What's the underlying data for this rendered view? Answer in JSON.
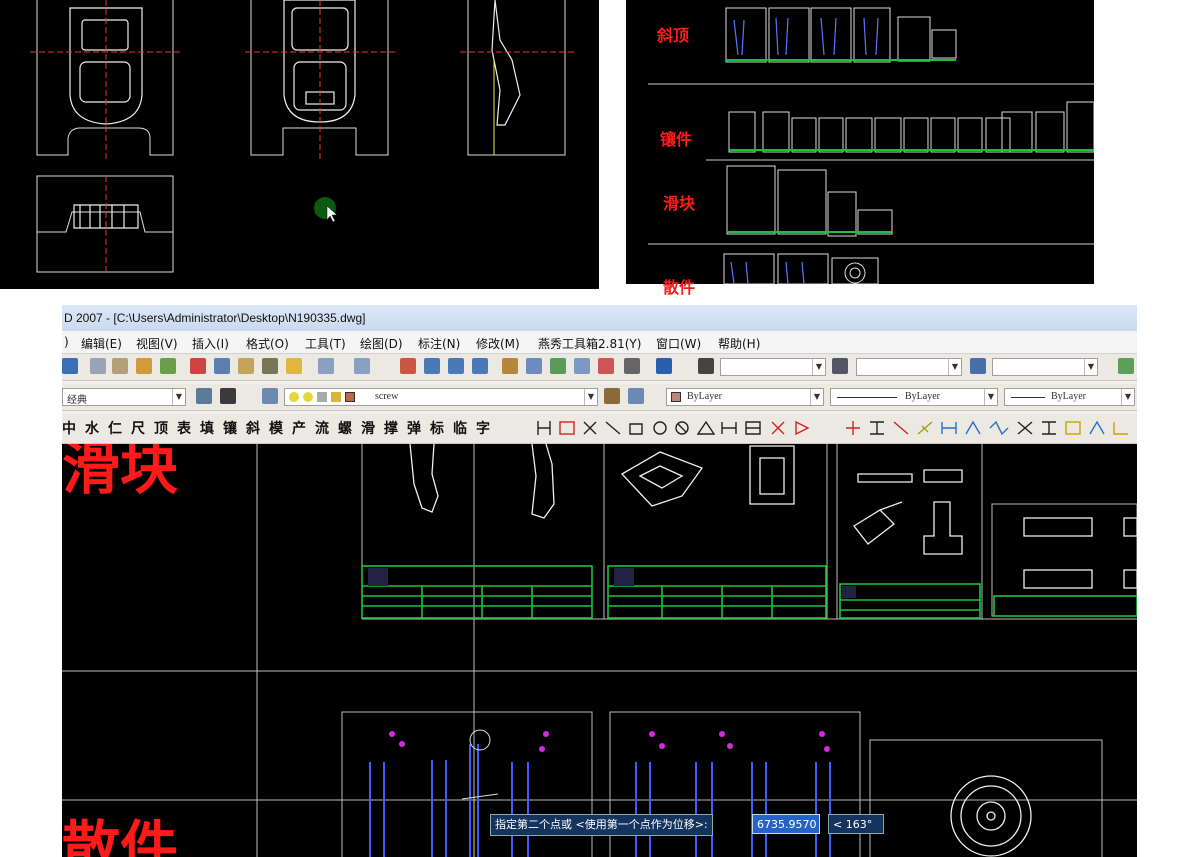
{
  "top_right_labels": [
    "斜顶",
    "镶件",
    "滑块",
    "散件"
  ],
  "window": {
    "title": "D 2007 - [C:\\Users\\Administrator\\Desktop\\N190335.dwg]"
  },
  "menu": [
    ")",
    "编辑(E)",
    "视图(V)",
    "插入(I)",
    "格式(O)",
    "工具(T)",
    "绘图(D)",
    "标注(N)",
    "修改(M)",
    "燕秀工具箱2.81(Y)",
    "窗口(W)",
    "帮助(H)"
  ],
  "toolbar2": {
    "workspace": "经典",
    "layer": "scrеw",
    "color": "ByLayer",
    "linetype": "ByLayer",
    "lineweight": "ByLayer"
  },
  "toolbar3_chars": [
    "中",
    "水",
    "仁",
    "尺",
    "顶",
    "表",
    "填",
    "镶",
    "斜",
    "模",
    "产",
    "流",
    "螺",
    "滑",
    "撑",
    "弹",
    "标",
    "临",
    "字"
  ],
  "drawing_labels": {
    "top_left": "滑块",
    "bottom_left": "散件"
  },
  "command": {
    "prompt": "指定第二个点或 <使用第一个点作为位移>:",
    "value": "6735.9570",
    "angle": "< 163°"
  },
  "colors": {
    "label_red": "#ff1a1a",
    "cad_bg": "#000000",
    "title_tag": "#0a7a2a"
  }
}
